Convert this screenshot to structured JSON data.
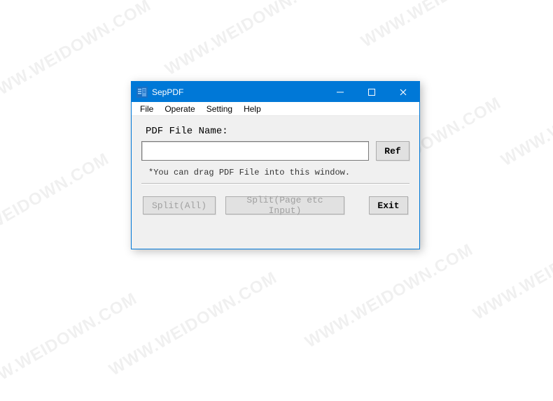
{
  "watermark_text": "WWW.WEIDOWN.COM",
  "window": {
    "title": "SepPDF"
  },
  "menubar": {
    "file": "File",
    "operate": "Operate",
    "setting": "Setting",
    "help": "Help"
  },
  "main": {
    "label": "PDF File Name:",
    "input_value": "",
    "ref_button": "Ref",
    "hint": "*You can drag PDF File into this window.",
    "split_all": "Split(All)",
    "split_page": "Split(Page etc Input)",
    "exit": "Exit"
  }
}
